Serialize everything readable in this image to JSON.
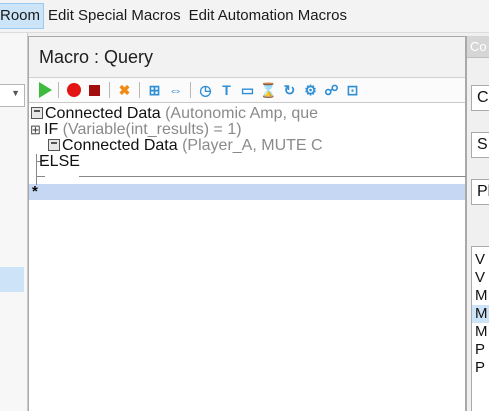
{
  "menubar": {
    "items": [
      "Room",
      "Edit Special Macros",
      "Edit Automation Macros"
    ]
  },
  "macro_panel": {
    "title": "Macro : Query",
    "toolbar_icons": [
      "play-icon",
      "record-icon",
      "stop-icon",
      "delete-icon",
      "if-block-icon",
      "swap-icon",
      "timer-icon",
      "text-icon",
      "variable-icon",
      "wait-icon",
      "loop-icon",
      "settings-icon",
      "device-icon",
      "connect-icon"
    ],
    "lines": [
      {
        "keyword": "Connected Data",
        "args": "(Autonomic Amp, que"
      },
      {
        "keyword": "IF",
        "args": "(Variable(int_results) = 1)"
      },
      {
        "keyword": "Connected Data",
        "args": "(Player_A, MUTE C"
      },
      {
        "keyword": "ELSE",
        "args": ""
      }
    ],
    "new_row_marker": "*"
  },
  "right_panel": {
    "title_fragment": "Co",
    "fields": [
      "C",
      "SI",
      "Pl"
    ],
    "list_items": [
      "V",
      "V",
      "M",
      "M",
      "M",
      "P",
      "P"
    ],
    "selected_index": 3
  },
  "colors": {
    "selection": "#c5d7f2",
    "menu_highlight": "#cce4f7",
    "play": "#3dbb3d",
    "record": "#e21414",
    "icon_blue": "#2e8fd6"
  }
}
